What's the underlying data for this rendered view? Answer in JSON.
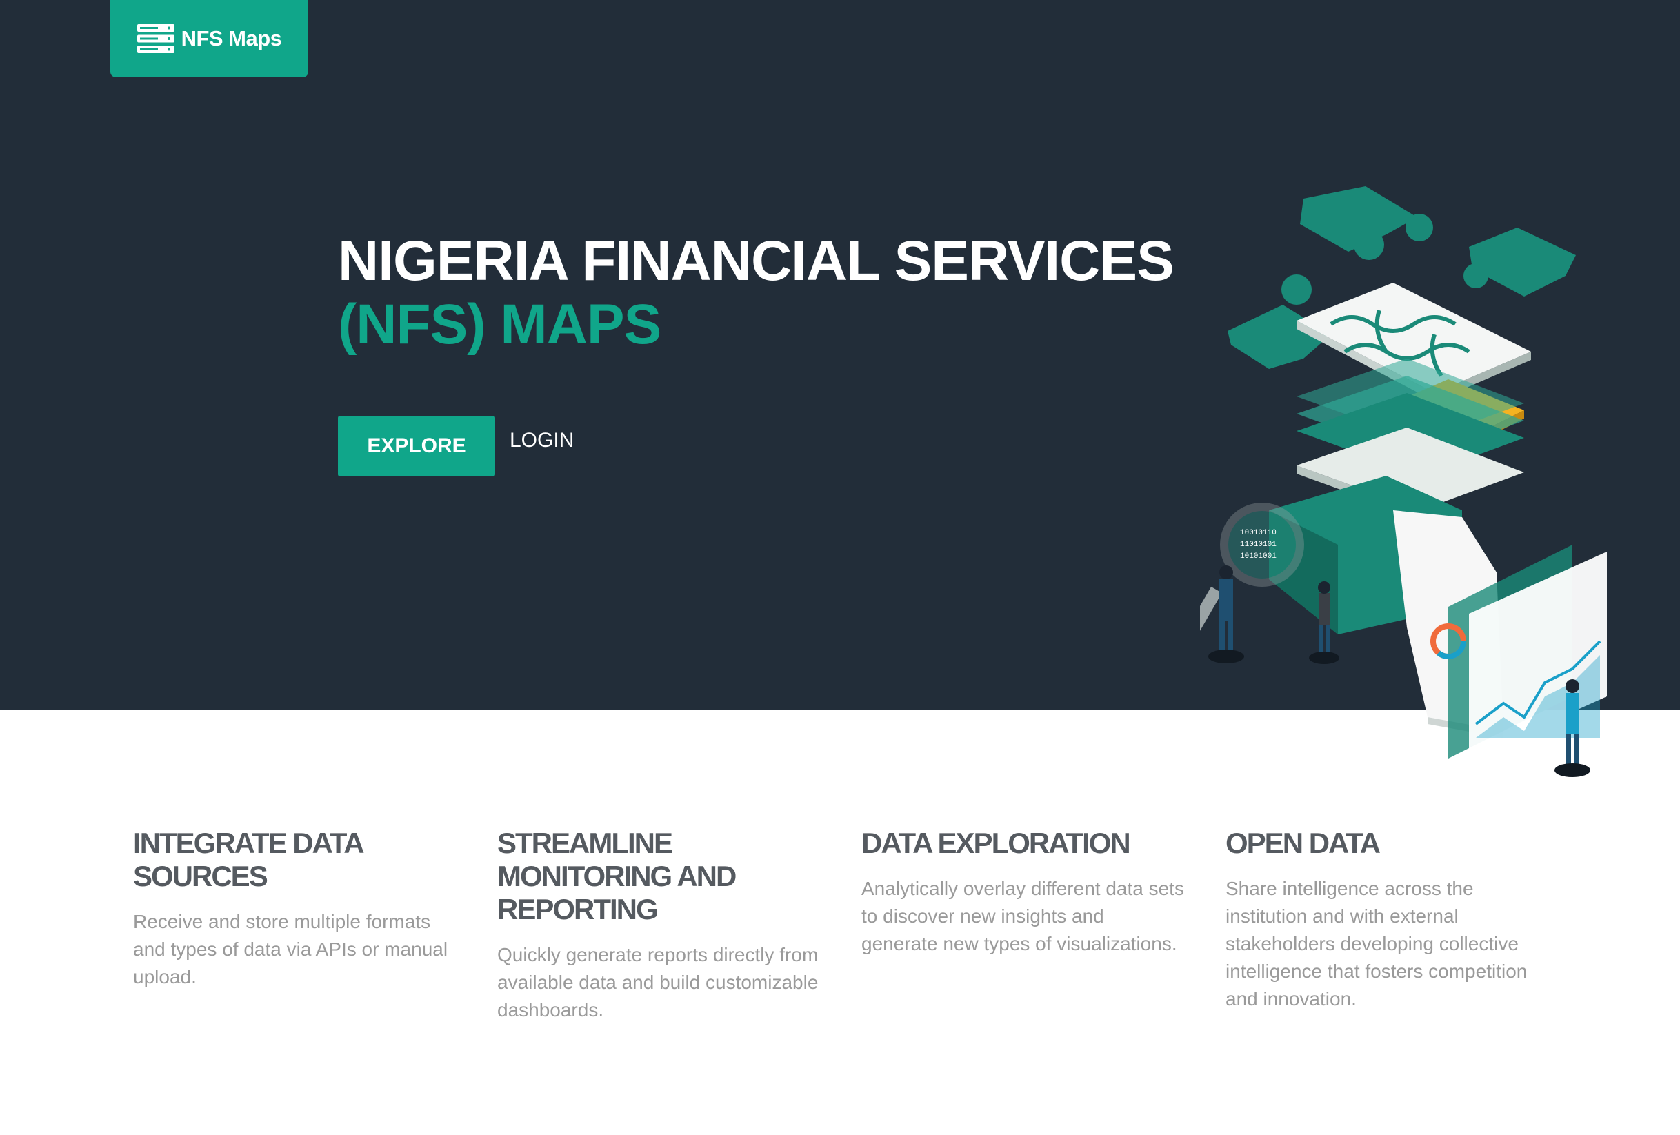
{
  "brand": {
    "logo_text": "NFS Maps",
    "logo_icon": "server-stack-icon",
    "accent_color": "#10a68a",
    "hero_bg_color": "#222d39"
  },
  "hero": {
    "title_line1": "NIGERIA FINANCIAL SERVICES",
    "title_line2": "(NFS) MAPS",
    "explore_label": "EXPLORE",
    "login_label": "LOGIN",
    "illustration": "isometric-puzzle-data-illustration"
  },
  "features": [
    {
      "title": "INTEGRATE DATA SOURCES",
      "text": "Receive and store multiple formats and types of data via APIs or manual upload."
    },
    {
      "title": "STREAMLINE MONITORING AND REPORTING",
      "text": "Quickly generate reports directly from available data and build customizable dashboards."
    },
    {
      "title": "DATA EXPLORATION",
      "text": "Analytically overlay different data sets to discover new insights and generate new types of visualizations."
    },
    {
      "title": "OPEN DATA",
      "text": "Share intelligence across the institution and with external stakeholders developing collective intelligence that fosters competition and innovation."
    }
  ]
}
